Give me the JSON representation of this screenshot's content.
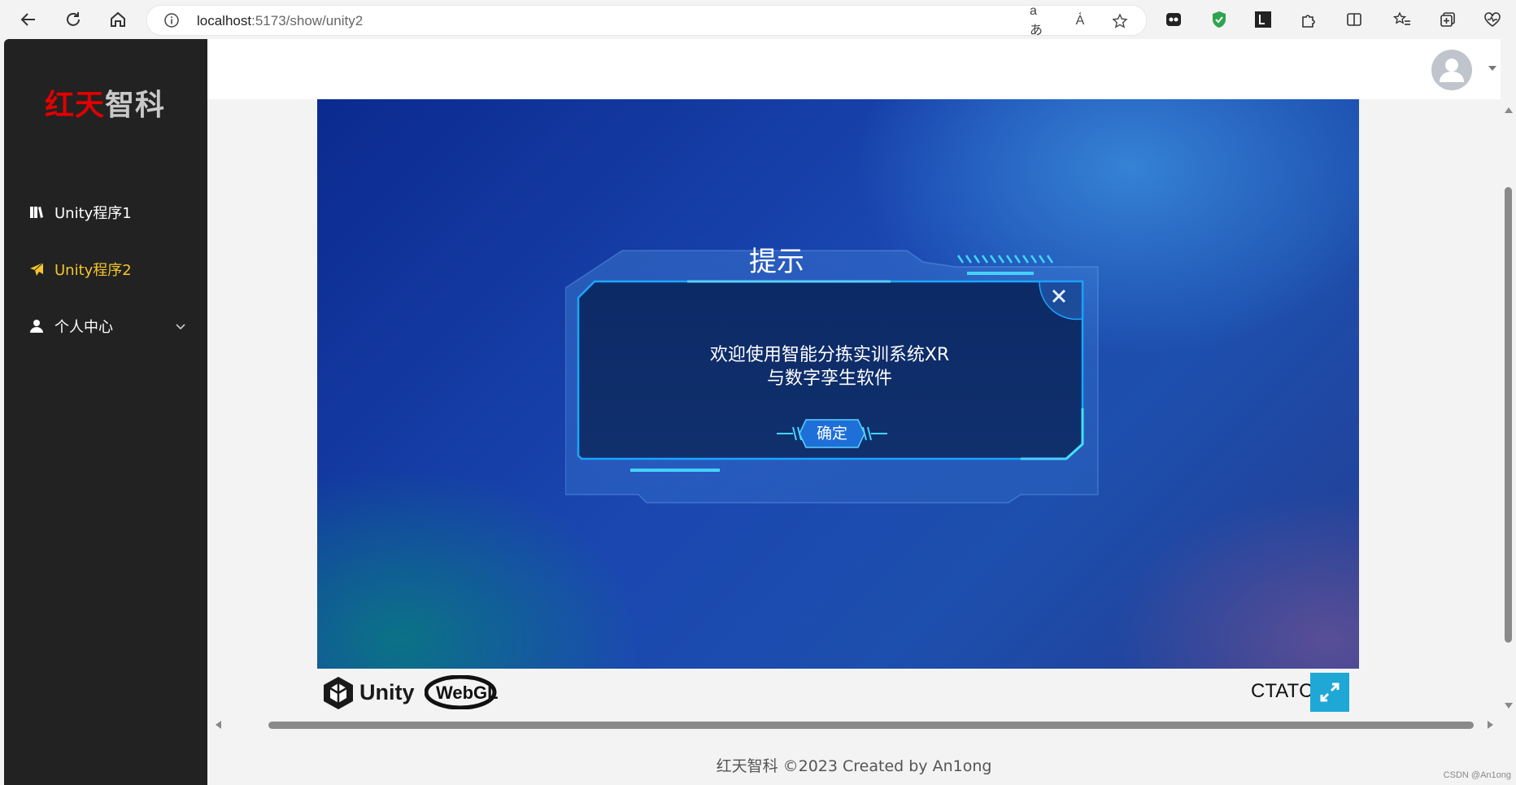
{
  "browser": {
    "url_host": "localhost",
    "url_path": ":5173/show/unity2"
  },
  "sidebar": {
    "logo": {
      "part1": "红天",
      "part2": "智科"
    },
    "items": [
      {
        "label": "Unity程序1",
        "icon": "book-icon",
        "active": false
      },
      {
        "label": "Unity程序2",
        "icon": "paper-plane-icon",
        "active": true
      },
      {
        "label": "个人中心",
        "icon": "user-icon",
        "active": false,
        "has_submenu": true
      }
    ]
  },
  "header": {
    "avatar": "default-avatar"
  },
  "unity": {
    "dialog": {
      "title": "提示",
      "message_line1": "欢迎使用智能分拣实训系统XR",
      "message_line2": "与数字孪生软件",
      "ok_label": "确定"
    },
    "footer": {
      "unity_word": "Unity",
      "webgl_word": "WebGL",
      "title": "CTATC"
    }
  },
  "footer": {
    "copyright": "红天智科 ©2023 Created by An1ong"
  },
  "watermark": "CSDN @An1ong",
  "colors": {
    "sidebar_bg": "#222222",
    "active_menu": "#f4c52c",
    "logo_red": "#e00000",
    "fullscreen_btn": "#1fa7d6"
  }
}
